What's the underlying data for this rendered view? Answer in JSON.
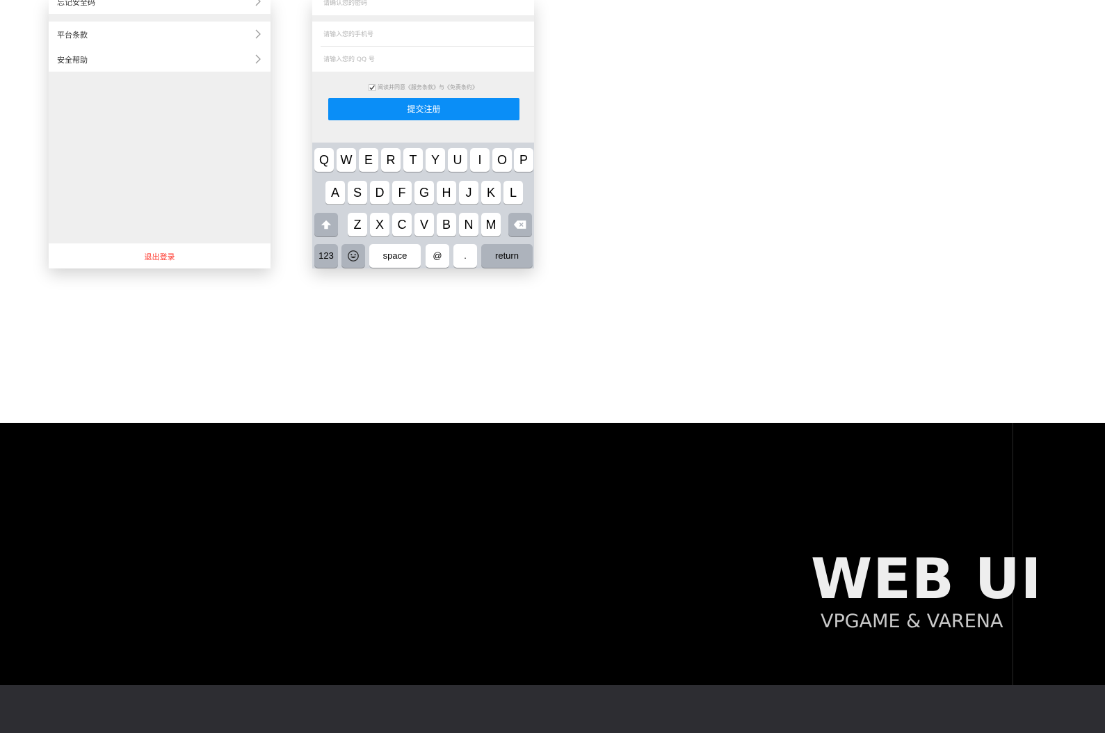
{
  "settings_screen": {
    "items": [
      {
        "label": "忘记安全码"
      },
      {
        "label": "平台条款"
      },
      {
        "label": "安全帮助"
      }
    ],
    "logout_label": "退出登录",
    "logout_color": "#ff3b30"
  },
  "register_screen": {
    "fields": [
      {
        "placeholder": "请确认您的密码"
      },
      {
        "placeholder": "请输入您的手机号"
      },
      {
        "placeholder": "请输入您的 QQ 号"
      }
    ],
    "agreement_text": "阅读并同意《服务条款》与《免责条约》",
    "submit_label": "提交注册",
    "accent_color": "#0a8ef7"
  },
  "keyboard": {
    "row1": [
      "Q",
      "W",
      "E",
      "R",
      "T",
      "Y",
      "U",
      "I",
      "O",
      "P"
    ],
    "row2": [
      "A",
      "S",
      "D",
      "F",
      "G",
      "H",
      "J",
      "K",
      "L"
    ],
    "row3": [
      "Z",
      "X",
      "C",
      "V",
      "B",
      "N",
      "M"
    ],
    "bottom": {
      "numbers_label": "123",
      "space_label": "space",
      "at_label": "@",
      "dot_label": ".",
      "return_label": "return"
    }
  },
  "banner": {
    "title": "WEB UI",
    "subtitle": "VPGAME & VARENA"
  }
}
